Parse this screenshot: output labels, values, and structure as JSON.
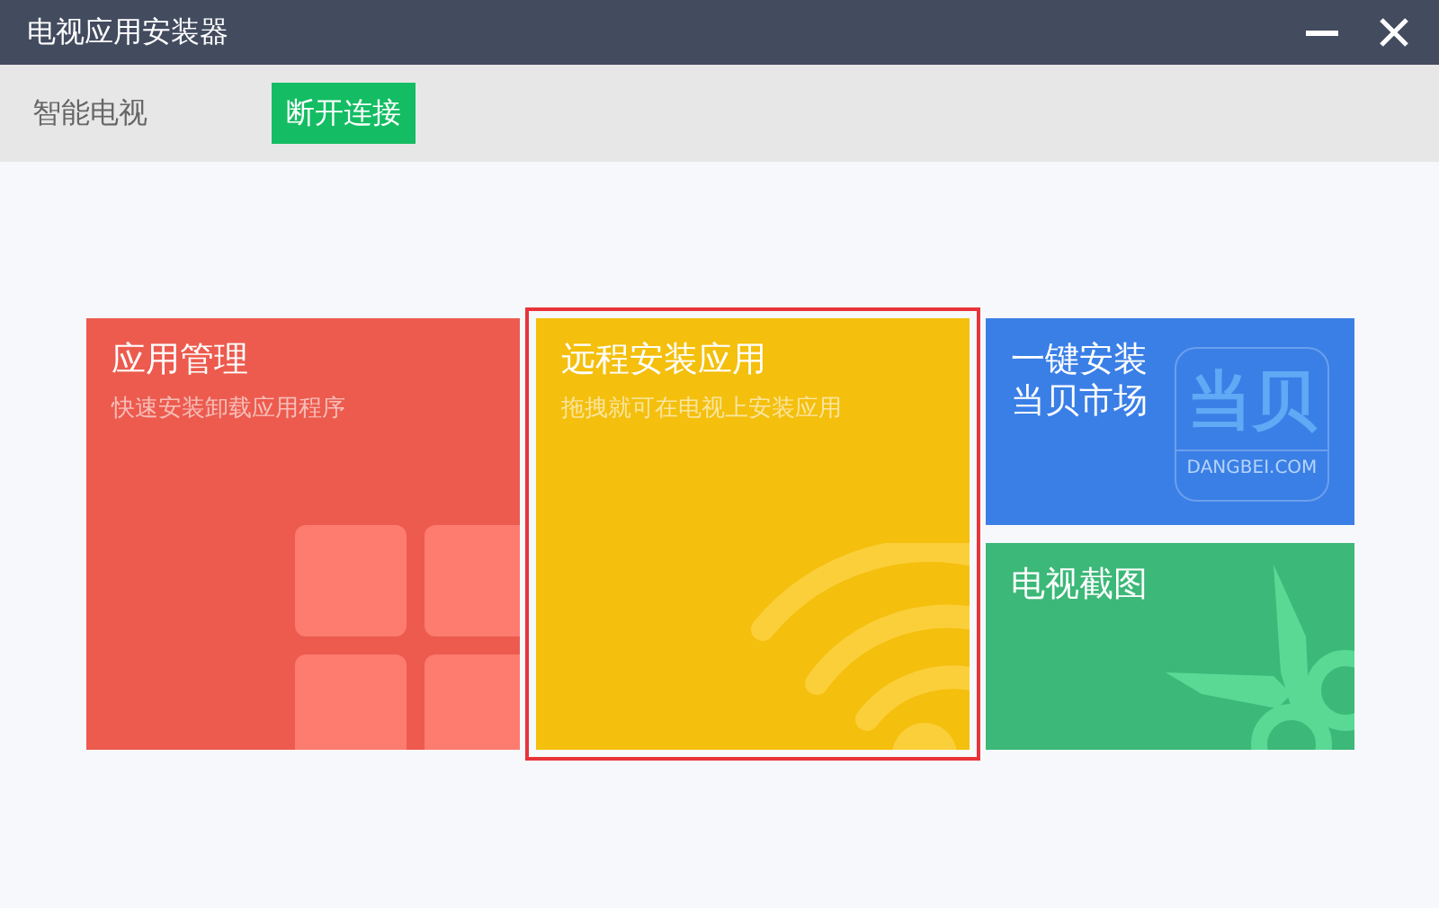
{
  "window": {
    "title": "电视应用安装器",
    "controls": [
      {
        "kind": "minimize"
      },
      {
        "kind": "close"
      }
    ]
  },
  "toolbar": {
    "device": "智能电视",
    "disconnect_button": "断开连接"
  },
  "tiles": [
    {
      "kind": "apps",
      "title": "应用管理",
      "subtitle": "快速安装卸载应用程序",
      "color": "#ec5b4e",
      "selected": false
    },
    {
      "kind": "remote",
      "title": "远程安装应用",
      "subtitle": "拖拽就可在电视上安装应用",
      "color": "#f4bf0d",
      "selected": true
    },
    {
      "kind": "market",
      "title": "一键安装当贝市场",
      "logo_text": "当贝",
      "logo_caption": "DANGBEI.COM",
      "color": "#3a7fe6",
      "selected": false
    },
    {
      "kind": "screenshot",
      "title": "电视截图",
      "color": "#3cb878",
      "selected": false
    }
  ]
}
